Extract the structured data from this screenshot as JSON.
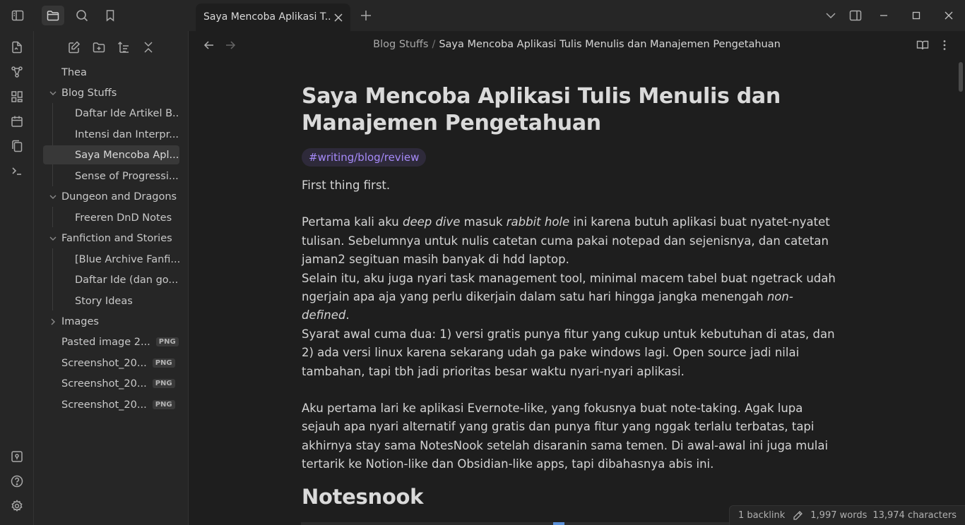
{
  "tab": {
    "title": "Saya Mencoba Aplikasi T..."
  },
  "breadcrumb": {
    "parent": "Blog Stuffs",
    "separator": "/",
    "current": "Saya Mencoba Aplikasi Tulis Menulis dan Manajemen Pengetahuan"
  },
  "sidebar": {
    "vault": "Thea",
    "items": [
      {
        "label": "Blog Stuffs",
        "type": "folder",
        "expanded": true
      },
      {
        "label": "Daftar Ide Artikel B...",
        "type": "file"
      },
      {
        "label": "Intensi dan Interpr...",
        "type": "file"
      },
      {
        "label": "Saya Mencoba Apl...",
        "type": "file",
        "active": true
      },
      {
        "label": "Sense of Progressi...",
        "type": "file"
      },
      {
        "label": "Dungeon and Dragons",
        "type": "folder",
        "expanded": true
      },
      {
        "label": "Freeren DnD Notes",
        "type": "file"
      },
      {
        "label": "Fanfiction and Stories",
        "type": "folder",
        "expanded": true
      },
      {
        "label": "[Blue Archive Fanfi...",
        "type": "file"
      },
      {
        "label": "Daftar Ide (dan go...",
        "type": "file"
      },
      {
        "label": "Story Ideas",
        "type": "file"
      },
      {
        "label": "Images",
        "type": "folder",
        "expanded": false
      },
      {
        "label": "Pasted image 2...",
        "type": "file",
        "badge": "PNG"
      },
      {
        "label": "Screenshot_20...",
        "type": "file",
        "badge": "PNG"
      },
      {
        "label": "Screenshot_20...",
        "type": "file",
        "badge": "PNG"
      },
      {
        "label": "Screenshot_20...",
        "type": "file",
        "badge": "PNG"
      }
    ]
  },
  "document": {
    "title": "Saya Mencoba Aplikasi Tulis Menulis dan Manajemen Pengetahuan",
    "tag": "#writing/blog/review",
    "p1": "First thing first.",
    "p2a": "Pertama kali aku ",
    "p2b": "deep dive",
    "p2c": " masuk ",
    "p2d": "rabbit hole",
    "p2e": " ini karena butuh aplikasi buat nyatet-nyatet tulisan. Sebelumnya untuk nulis catetan cuma pakai notepad dan sejenisnya, dan catetan jaman2 segituan masih banyak di hdd laptop.",
    "p3a": "Selain itu, aku juga nyari task management tool, minimal macem tabel buat ngetrack udah ngerjain apa aja yang perlu dikerjain dalam satu hari hingga jangka menengah ",
    "p3b": "non-defined",
    "p3c": ".",
    "p4": "Syarat awal cuma dua: 1) versi gratis punya fitur yang cukup untuk kebutuhan di atas, dan 2) ada versi linux karena sekarang udah ga pake windows lagi. Open source jadi nilai tambahan, tapi tbh jadi prioritas besar waktu nyari-nyari aplikasi.",
    "p5": "Aku pertama lari ke aplikasi Evernote-like, yang fokusnya buat note-taking. Agak lupa sejauh apa nyari alternatif yang gratis dan punya fitur yang nggak terlalu terbatas, tapi akhirnya stay sama NotesNook setelah disaranin sama temen. Di awal-awal ini juga mulai tertarik ke Notion-like dan Obsidian-like apps, tapi dibahasnya abis ini.",
    "h2": "Notesnook"
  },
  "status": {
    "backlinks": "1 backlink",
    "words": "1,997 words",
    "characters": "13,974 characters"
  },
  "colors": {
    "accent": "#a68af9",
    "background": "#1e1e1e",
    "panel": "#262626"
  }
}
